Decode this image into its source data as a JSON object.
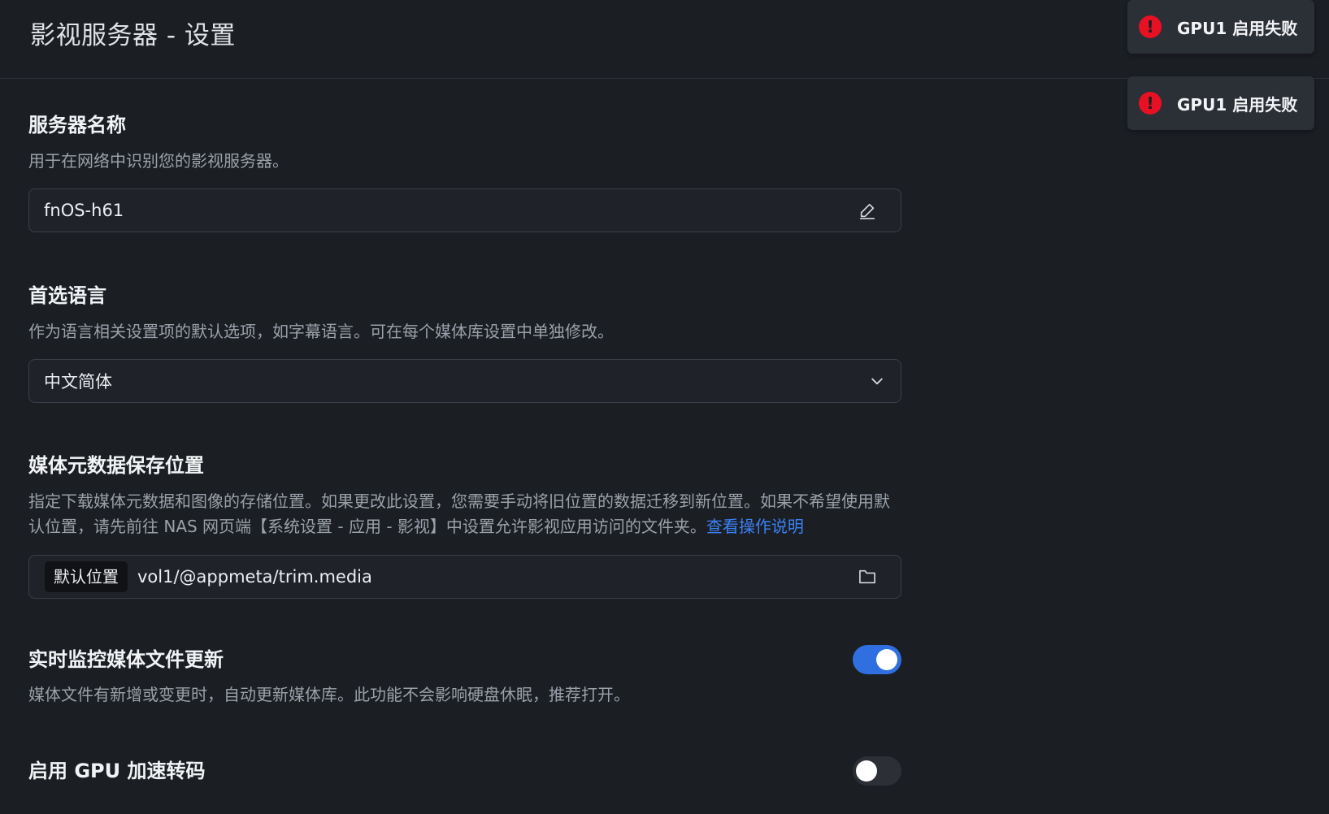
{
  "page_title": "影视服务器 - 设置",
  "toasts": [
    {
      "message": "GPU1 启用失败",
      "icon": "error-icon"
    },
    {
      "message": "GPU1 启用失败",
      "icon": "error-icon"
    }
  ],
  "server_name": {
    "title": "服务器名称",
    "description": "用于在网络中识别您的影视服务器。",
    "value": "fnOS-h61",
    "icon": "edit-icon"
  },
  "language": {
    "title": "首选语言",
    "description": "作为语言相关设置项的默认选项，如字幕语言。可在每个媒体库设置中单独修改。",
    "selected": "中文简体",
    "icon": "chevron-down-icon"
  },
  "metadata_location": {
    "title": "媒体元数据保存位置",
    "description": "指定下载媒体元数据和图像的存储位置。如果更改此设置，您需要手动将旧位置的数据迁移到新位置。如果不希望使用默认位置，请先前往 NAS 网页端【系统设置 - 应用 - 影视】中设置允许影视应用访问的文件夹。",
    "help_link": "查看操作说明",
    "tag": "默认位置",
    "path": "vol1/@appmeta/trim.media",
    "icon": "folder-icon"
  },
  "realtime_monitor": {
    "title": "实时监控媒体文件更新",
    "description": "媒体文件有新增或变更时，自动更新媒体库。此功能不会影响硬盘休眠，推荐打开。",
    "enabled": true
  },
  "gpu_transcode": {
    "title": "启用 GPU 加速转码",
    "enabled": false
  },
  "colors": {
    "background": "#1b1e23",
    "accent": "#2f6fe0",
    "link": "#3b82f6",
    "error": "#e81123"
  }
}
